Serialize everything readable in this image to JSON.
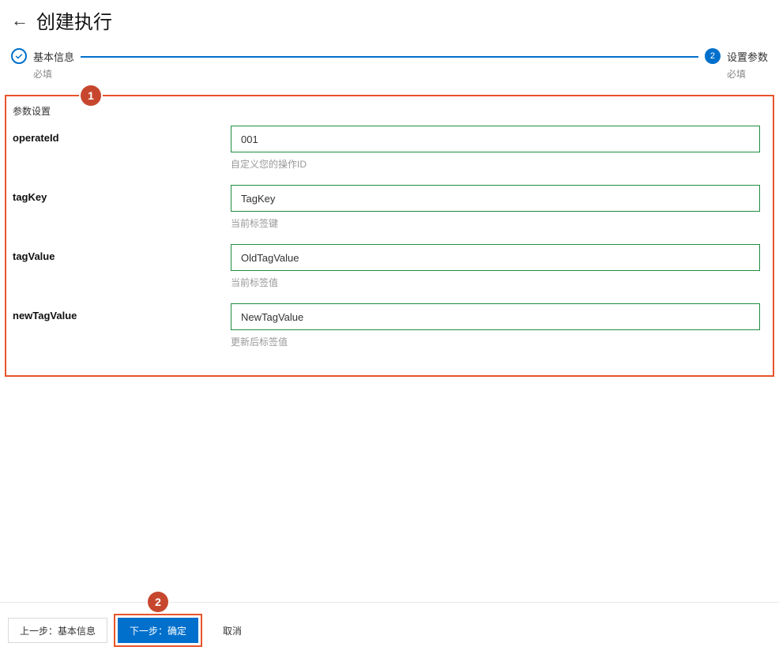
{
  "header": {
    "title": "创建执行"
  },
  "stepper": {
    "step1": {
      "label": "基本信息",
      "sub": "必填"
    },
    "step2": {
      "number": "2",
      "label": "设置参数",
      "sub": "必填"
    }
  },
  "panel": {
    "title": "参数设置",
    "fields": [
      {
        "label": "operateId",
        "value": "001",
        "hint": "自定义您的操作ID"
      },
      {
        "label": "tagKey",
        "value": "TagKey",
        "hint": "当前标签键"
      },
      {
        "label": "tagValue",
        "value": "OldTagValue",
        "hint": "当前标签值"
      },
      {
        "label": "newTagValue",
        "value": "NewTagValue",
        "hint": "更新后标签值"
      }
    ]
  },
  "callouts": {
    "one": "1",
    "two": "2"
  },
  "footer": {
    "prev": "上一步：基本信息",
    "next": "下一步：确定",
    "cancel": "取消"
  }
}
